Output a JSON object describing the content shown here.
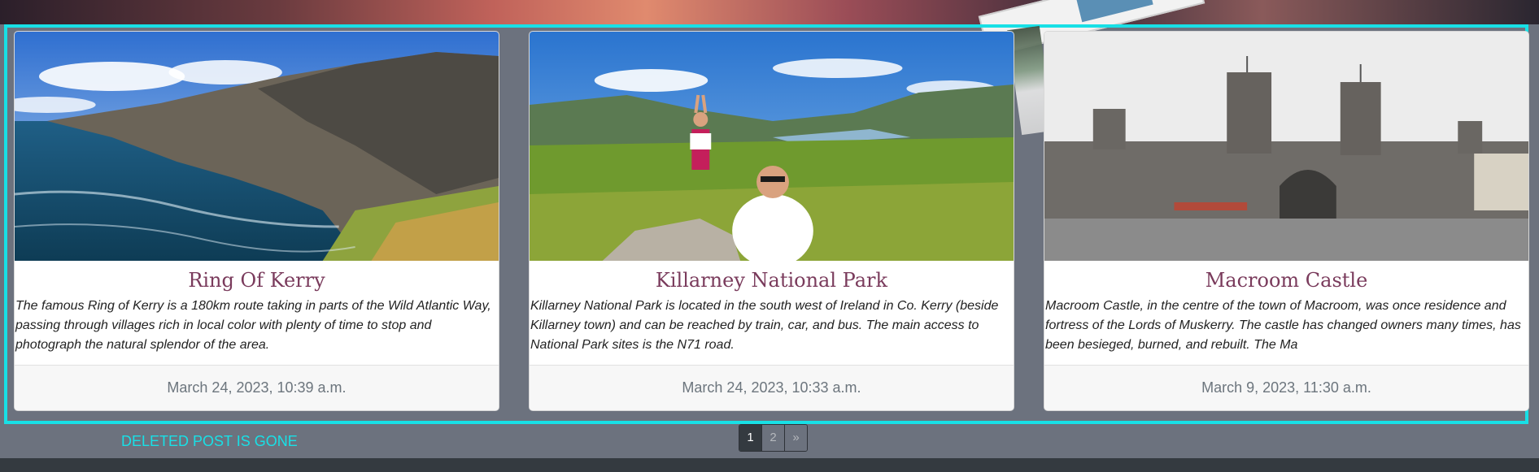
{
  "cards": [
    {
      "title": "Ring Of Kerry",
      "excerpt": "The famous Ring of Kerry is a 180km route taking in parts of the Wild Atlantic Way, passing through villages rich in local color with plenty of time to stop and photograph the natural splendor of the area.",
      "date": "March 24, 2023, 10:39 a.m."
    },
    {
      "title": "Killarney National Park",
      "excerpt": "Killarney National Park is located in the south west of Ireland in Co. Kerry (beside Killarney town) and can be reached by train, car, and bus. The main access to National Park sites is the N71 road.",
      "date": "March 24, 2023, 10:33 a.m."
    },
    {
      "title": "Macroom Castle",
      "excerpt": "Macroom Castle, in the centre of the town of Macroom, was once residence and fortress of the Lords of Muskerry. The castle has changed owners many times, has been besieged, burned, and rebuilt. The Ma",
      "date": "March 9, 2023, 11:30 a.m."
    }
  ],
  "message": "DELETED POST IS GONE",
  "pagination": [
    "1",
    "2",
    "»"
  ],
  "colors": {
    "highlight": "#18e0e6",
    "title": "#7a3b5c",
    "footer_bar": "#343a40"
  }
}
